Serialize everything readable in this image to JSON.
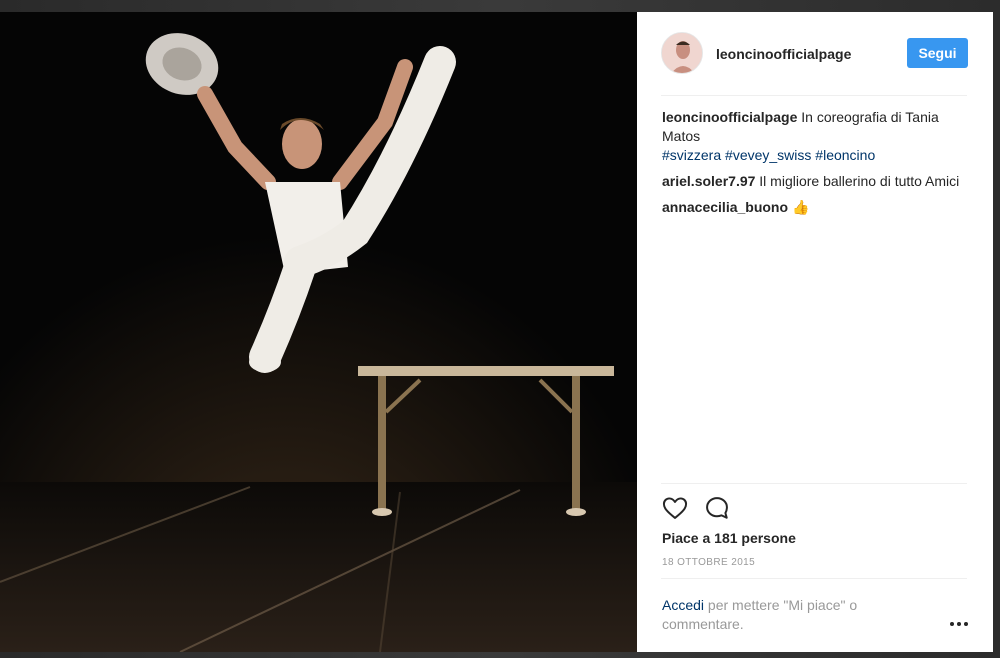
{
  "post": {
    "username": "leoncinoofficialpage",
    "follow_label": "Segui",
    "caption": {
      "user": "leoncinoofficialpage",
      "text": "In coreografia di Tania Matos",
      "hashtags": [
        "#svizzera",
        "#vevey_swiss",
        "#leoncino"
      ]
    },
    "comments": [
      {
        "user": "ariel.soler7.97",
        "text": "Il migliore ballerino di tutto Amici"
      },
      {
        "user": "annacecilia_buono",
        "text": "👍"
      }
    ],
    "likes_text": "Piace a 181 persone",
    "date": "18 OTTOBRE 2015",
    "login_prompt": {
      "link": "Accedi",
      "text": "per mettere \"Mi piace\" o commentare."
    },
    "icons": {
      "like": "heart-icon",
      "comment": "comment-bubble-icon",
      "more": "more-options-icon"
    }
  },
  "colors": {
    "accent": "#3897f0",
    "hashtag": "#003569",
    "text": "#262626",
    "muted": "#999999"
  }
}
